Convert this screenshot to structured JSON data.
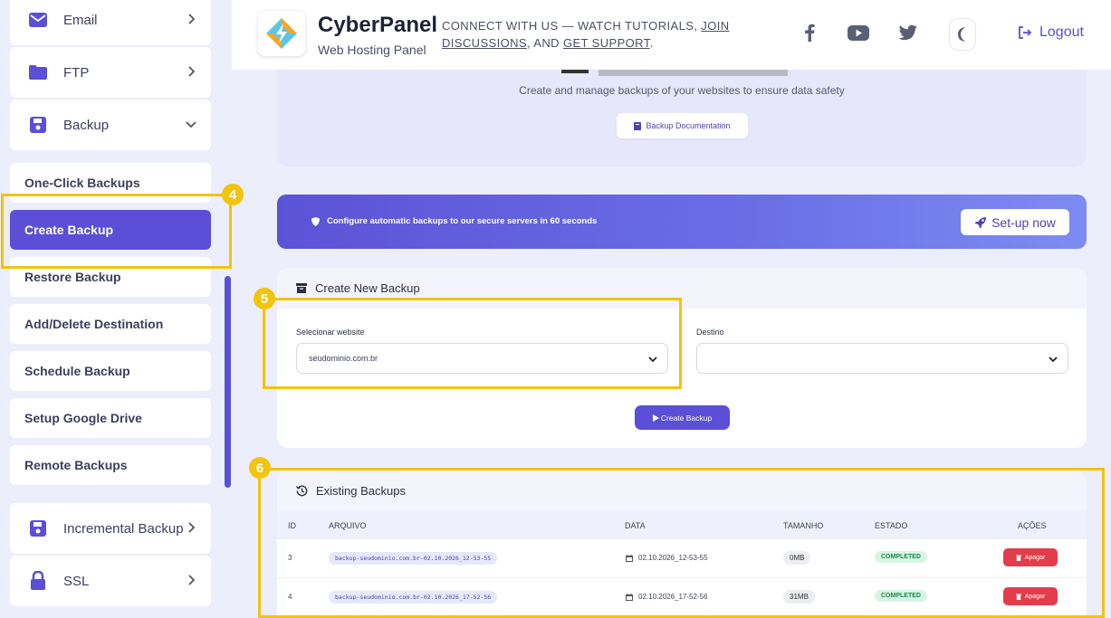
{
  "sidebar": {
    "top_items": [
      {
        "label": "Email",
        "icon": "mail-icon"
      },
      {
        "label": "FTP",
        "icon": "folder-icon"
      },
      {
        "label": "Backup",
        "icon": "floppy-icon"
      }
    ],
    "sub_items": [
      {
        "label": "One-Click Backups"
      },
      {
        "label": "Create Backup"
      },
      {
        "label": "Restore Backup"
      },
      {
        "label": "Add/Delete Destination"
      },
      {
        "label": "Schedule Backup"
      },
      {
        "label": "Setup Google Drive"
      },
      {
        "label": "Remote Backups"
      }
    ],
    "bottom_items": [
      {
        "label": "Incremental Backup",
        "icon": "floppy-icon"
      },
      {
        "label": "SSL",
        "icon": "lock-icon"
      }
    ]
  },
  "header": {
    "brand": "CyberPanel",
    "subtitle": "Web Hosting Panel",
    "connect_prefix": "CONNECT WITH US — WATCH TUTORIALS, ",
    "connect_link1": "JOIN DISCUSSIONS",
    "connect_mid": ", AND ",
    "connect_link2": "GET SUPPORT",
    "connect_suffix": ".",
    "logout_label": "Logout"
  },
  "hero": {
    "description": "Create and manage backups of your websites to ensure data safety",
    "doc_button": "Backup Documentation"
  },
  "banner": {
    "text": "Configure automatic backups to our secure servers in 60 seconds",
    "button": "Set-up now"
  },
  "create_backup": {
    "title": "Create New Backup",
    "website_label": "Selecionar website",
    "website_value": "seudominio.com.br",
    "destination_label": "Destino",
    "destination_value": "",
    "button": "Create Backup"
  },
  "existing_backups": {
    "title": "Existing Backups",
    "columns": [
      "ID",
      "ARQUIVO",
      "DATA",
      "TAMANHO",
      "ESTADO",
      "AÇÕES"
    ],
    "rows": [
      {
        "id": "3",
        "file": "backup-seudominio.com.br-02.10.2026_12-53-55",
        "date": "02.10.2026_12-53-55",
        "size": "0MB",
        "status": "COMPLETED",
        "action": "Apagar"
      },
      {
        "id": "4",
        "file": "backup-seudominio.com.br-02.10.2026_17-52-56",
        "date": "02.10.2026_17-52-56",
        "size": "31MB",
        "status": "COMPLETED",
        "action": "Apagar"
      }
    ]
  },
  "annotations": [
    "4",
    "5",
    "6"
  ],
  "colors": {
    "accent": "#5a4fd6",
    "annotation": "#f2c40c",
    "danger": "#e33d4b",
    "success": "#1c8a4c"
  }
}
